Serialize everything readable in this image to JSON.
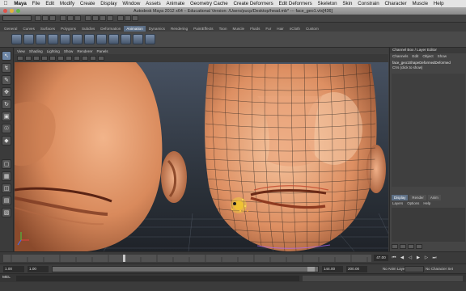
{
  "menubar": {
    "app": "Maya",
    "items": [
      "File",
      "Edit",
      "Modify",
      "Create",
      "Display",
      "Window",
      "Assets",
      "Animate",
      "Geometry Cache",
      "Create Deformers",
      "Edit Deformers",
      "Skeleton",
      "Skin",
      "Constrain",
      "Character",
      "Muscle",
      "Help"
    ]
  },
  "window": {
    "title": "Autodesk Maya 2012 x64 – Educational Version: /Users/pucp/Desktop/head.mb* --- face_geo1.vtx[436]"
  },
  "shelf": {
    "tabs": [
      "General",
      "Curves",
      "Surfaces",
      "Polygons",
      "Subdivs",
      "Deformation",
      "Animation",
      "Dynamics",
      "Rendering",
      "PaintEffects",
      "Toon",
      "Muscle",
      "Fluids",
      "Fur",
      "Hair",
      "nCloth",
      "Custom"
    ],
    "active_tab": "Animation",
    "tab_color_active": "#5b6e86"
  },
  "viewport": {
    "panel_menu": [
      "View",
      "Shading",
      "Lighting",
      "Show",
      "Renderer",
      "Panels"
    ],
    "background": "#2a2f36",
    "skin_color": "#d98a5c",
    "wire_color": "#1a1a1a"
  },
  "channel_box": {
    "title": "Channel Box / Layer Editor",
    "menu": [
      "Channels",
      "Edit",
      "Object",
      "Show"
    ],
    "object_name": "face_geo1ShapeDeformedDeformed",
    "object_hint": "CVs (click to show)",
    "layer_tabs": [
      "Display",
      "Render",
      "Anim"
    ],
    "active_layer_tab": "Display",
    "layer_menu": [
      "Layers",
      "Options",
      "Help"
    ]
  },
  "time_slider": {
    "current_frame": "47.00",
    "playback_icons": [
      "skip-start-icon",
      "step-back-icon",
      "play-back-icon",
      "play-icon",
      "step-forward-icon",
      "skip-end-icon"
    ]
  },
  "range_slider": {
    "start_field": "1.00",
    "inner_start": "1.00",
    "inner_end": "144.00",
    "end_field": "200.00",
    "anim_layer_label": "No Anim Layer",
    "character_label": "No Character Set"
  },
  "command_line": {
    "label": "MEL"
  }
}
